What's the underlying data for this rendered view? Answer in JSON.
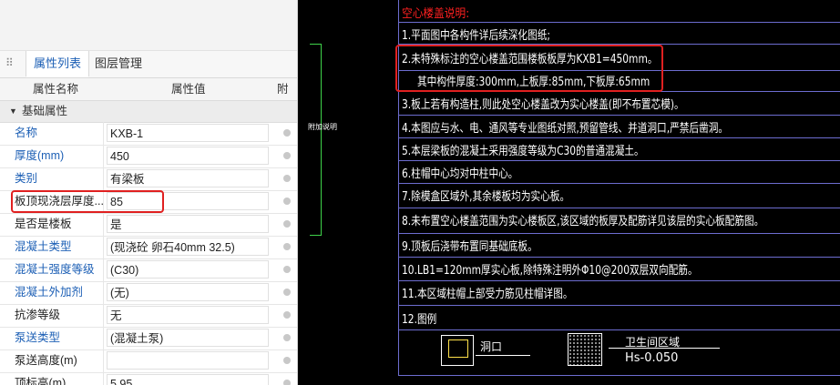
{
  "panel": {
    "tabs": [
      {
        "label": "属性列表",
        "active": true
      },
      {
        "label": "图层管理",
        "active": false
      }
    ],
    "columns": {
      "name": "属性名称",
      "value": "属性值",
      "extra": "附加"
    },
    "group": "基础属性",
    "rows": [
      {
        "name": "名称",
        "value": "KXB-1",
        "blue": true
      },
      {
        "name": "厚度(mm)",
        "value": "450",
        "blue": true
      },
      {
        "name": "类别",
        "value": "有梁板",
        "blue": true
      },
      {
        "name": "板顶现浇层厚度...",
        "value": "85",
        "blue": false
      },
      {
        "name": "是否是楼板",
        "value": "是",
        "blue": false
      },
      {
        "name": "混凝土类型",
        "value": "(现浇砼 卵石40mm 32.5)",
        "blue": true
      },
      {
        "name": "混凝土强度等级",
        "value": "(C30)",
        "blue": true
      },
      {
        "name": "混凝土外加剂",
        "value": "(无)",
        "blue": true
      },
      {
        "name": "抗渗等级",
        "value": "无",
        "blue": false
      },
      {
        "name": "泵送类型",
        "value": "(混凝土泵)",
        "blue": true
      },
      {
        "name": "泵送高度(m)",
        "value": "",
        "blue": false
      },
      {
        "name": "顶标高(m)",
        "value": "5.95",
        "blue": false
      }
    ]
  },
  "cad": {
    "small_label": "附加说明",
    "notes": [
      {
        "text": "空心楼盖说明:",
        "title": true
      },
      {
        "text": "1.平面图中各构件详后续深化图纸;"
      },
      {
        "text": "2.未特殊标注的空心楼盖范围楼板板厚为KXB1=450mm。"
      },
      {
        "text": "其中构件厚度:300mm,上板厚:85mm,下板厚:65mm"
      },
      {
        "text": "3.板上若有构造柱,则此处空心楼盖改为实心楼盖(即不布置芯模)。"
      },
      {
        "text": "4.本图应与水、电、通风等专业图纸对照,预留管线、并道洞口,严禁后凿洞。"
      },
      {
        "text": "5.本层梁板的混凝土采用强度等级为C30的普通混凝土。"
      },
      {
        "text": "6.柱帽中心均对中柱中心。"
      },
      {
        "text": "7.除模盒区域外,其余楼板均为实心板。"
      },
      {
        "text": "8.未布置空心楼盖范围为实心楼板区,该区域的板厚及配筋详见该层的实心板配筋图。"
      },
      {
        "text": "9.顶板后浇带布置同基础底板。"
      },
      {
        "text": "10.LB1=120mm厚实心板,除特殊注明外Φ10@200双层双向配筋。"
      },
      {
        "text": "11.本区域柱帽上部受力筋见柱帽详图。"
      },
      {
        "text": "12.图例"
      }
    ],
    "legend": {
      "hole_label": "洞口",
      "toilet_label": "卫生间区域",
      "toilet_elev": "Hs-0.050"
    }
  }
}
